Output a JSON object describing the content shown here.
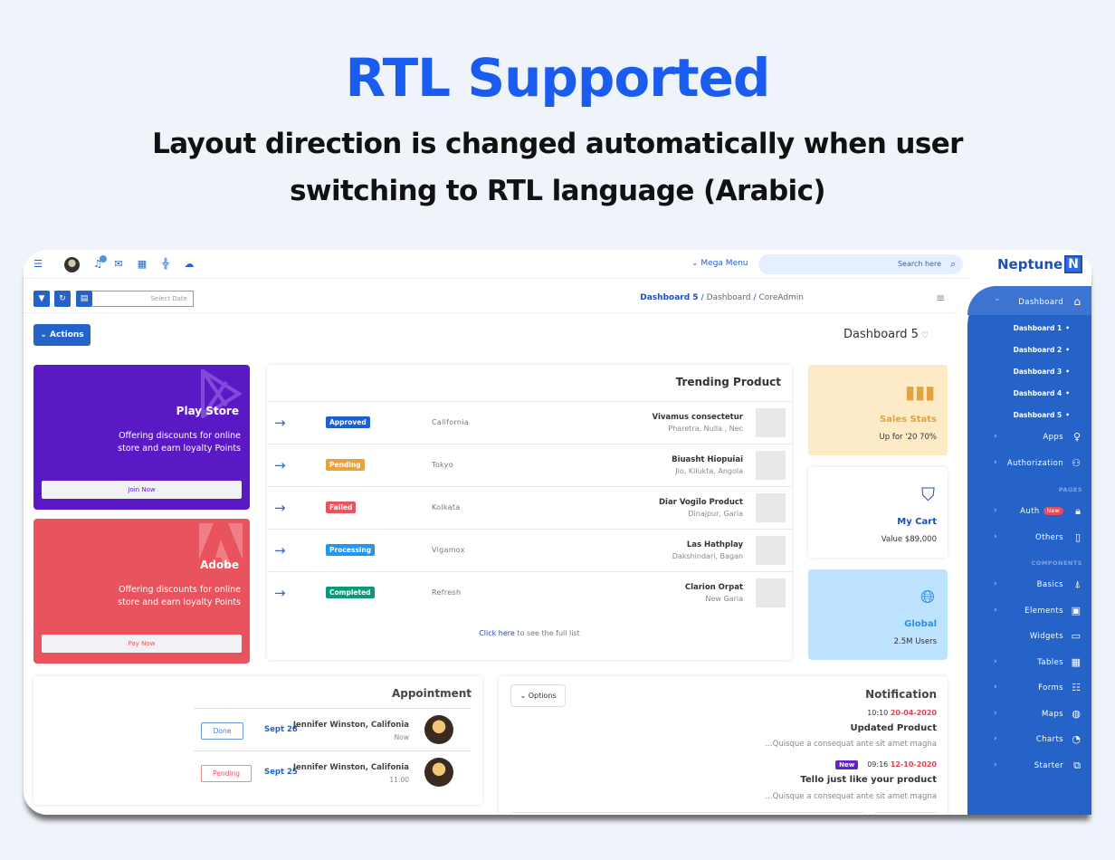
{
  "hero": {
    "title": "RTL Supported",
    "subtitle_line1": "Layout direction is changed automatically when user",
    "subtitle_line2": "switching to RTL language (Arabic)"
  },
  "topbar": {
    "icons": [
      "sliders-icon",
      "avatar",
      "bell-icon",
      "mail-icon",
      "translate-icon",
      "compress-icon",
      "cloud-icon"
    ],
    "mega_menu": "Mega Menu",
    "search_placeholder": "Search here",
    "brand": "Neptune",
    "brand_logo": "N"
  },
  "toolbar": {
    "date_placeholder": "Select Date",
    "breadcrumb": [
      "Dashboard 5",
      "Dashboard",
      "CoreAdmin"
    ]
  },
  "actions_label": "Actions",
  "page_title": "Dashboard 5",
  "promos": [
    {
      "title": "Play Store",
      "desc": "Offering discounts for online store and earn loyalty Points",
      "button": "Join Now",
      "color": "#5b19c6"
    },
    {
      "title": "Adobe",
      "desc": "Offering discounts for online store and earn loyalty Points",
      "button": "Pay Now",
      "color": "#e8535d"
    }
  ],
  "trending": {
    "title": "Trending Product",
    "rows": [
      {
        "status": "Approved",
        "status_color": "#1d5fd0",
        "location": "California",
        "name": "Vivamus consectetur",
        "sub": "Pharetra, Nulla , Nec",
        "image": "bag-black"
      },
      {
        "status": "Pending",
        "status_color": "#e8a33c",
        "location": "Tokyo",
        "name": "Biuasht Hiopuiai",
        "sub": "Jio, Kilukta, Angola",
        "image": "sneaker"
      },
      {
        "status": "Failed",
        "status_color": "#e8535d",
        "location": "Kolkata",
        "name": "Diar Vogilo Product",
        "sub": "Dinajpur, Garia",
        "image": "handbag-beige"
      },
      {
        "status": "Processing",
        "status_color": "#2196f3",
        "location": "Vigamox",
        "name": "Las Hathplay",
        "sub": "Dakshindari, Bagan",
        "image": "bag-grey"
      },
      {
        "status": "Completed",
        "status_color": "#0a9a7a",
        "location": "Refresh",
        "name": "Clarion Orpat",
        "sub": "New Garia",
        "image": "sunglasses"
      }
    ],
    "footer_link": "Click here",
    "footer_text": " to see the full list"
  },
  "stats": [
    {
      "title": "Sales Stats",
      "sub": "Up for '20 70%",
      "icon": "bar-chart-icon",
      "bg": "#fdebc8",
      "color": "#e2a23d"
    },
    {
      "title": "My Cart",
      "sub": "Value $89,000",
      "icon": "basket-icon",
      "bg": "#ffffff",
      "color": "#1d4fb5"
    },
    {
      "title": "Global",
      "sub": "2.5M Users",
      "icon": "globe-icon",
      "bg": "#bde3fe",
      "color": "#2a8ee8"
    }
  ],
  "appointment": {
    "title": "Appointment",
    "rows": [
      {
        "status": "Done",
        "date": "Sept 28",
        "name": "Jennifer Winston, Califonia",
        "time": "Now"
      },
      {
        "status": "Pending",
        "date": "Sept 25",
        "name": "Jennifer Winston, Califonia",
        "time": "11:00"
      }
    ]
  },
  "notification": {
    "options_label": "Options",
    "title": "Notification",
    "items": [
      {
        "time": "10:10",
        "date": "20-04-2020",
        "badge": "",
        "heading": "Updated Product",
        "desc": "...Quisque a consequat ante sit amet magna"
      },
      {
        "time": "09:16",
        "date": "12-10-2020",
        "badge": "New",
        "heading": "Tello just like your product",
        "desc": "...Quisque a consequat ante sit amet magna"
      }
    ]
  },
  "sidebar": {
    "dashboard": "Dashboard",
    "dashboards": [
      "Dashboard 1",
      "Dashboard 2",
      "Dashboard 3",
      "Dashboard 4",
      "Dashboard 5"
    ],
    "apps": "Apps",
    "authorization": "Authorization",
    "pages_header": "PAGES",
    "auth": "Auth",
    "auth_badge": "New",
    "others": "Others",
    "components_header": "COMPONENTS",
    "components": [
      "Basics",
      "Elements",
      "Widgets",
      "Tables",
      "Forms",
      "Maps",
      "Charts",
      "Starter"
    ]
  }
}
